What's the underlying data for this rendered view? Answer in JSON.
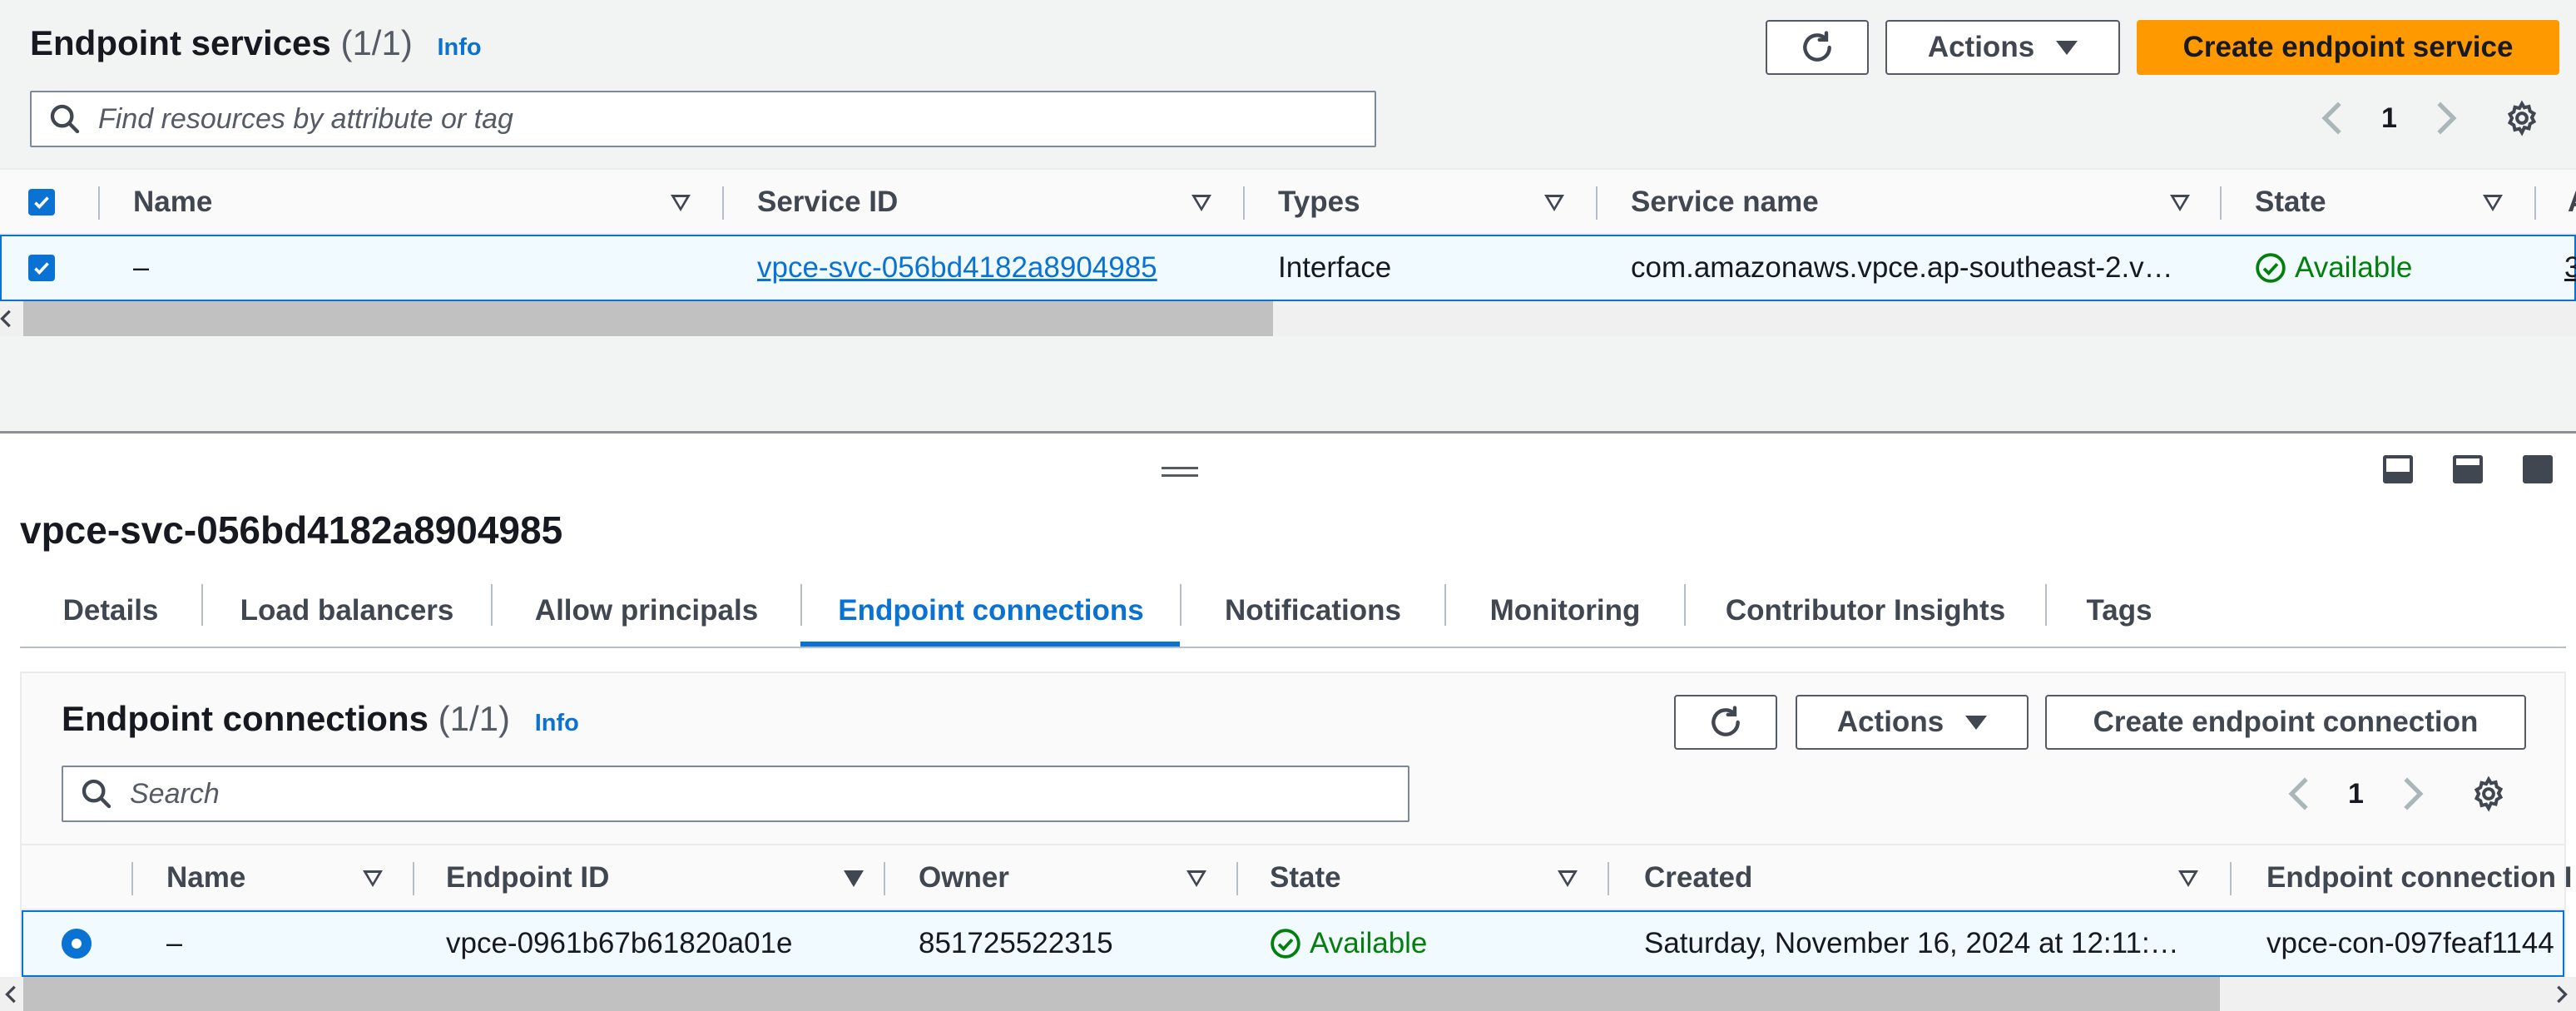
{
  "top": {
    "title": "Endpoint services",
    "count": "(1/1)",
    "info": "Info",
    "actions_label": "Actions",
    "create_label": "Create endpoint service",
    "search_placeholder": "Find resources by attribute or tag",
    "page": "1",
    "columns": [
      "Name",
      "Service ID",
      "Types",
      "Service name",
      "State",
      "A"
    ],
    "row": {
      "name": "–",
      "service_id": "vpce-svc-056bd4182a8904985",
      "type": "Interface",
      "service_name": "com.amazonaws.vpce.ap-southeast-2.v…",
      "state": "Available",
      "extra": "3"
    }
  },
  "detail": {
    "title": "vpce-svc-056bd4182a8904985",
    "tabs": [
      "Details",
      "Load balancers",
      "Allow principals",
      "Endpoint connections",
      "Notifications",
      "Monitoring",
      "Contributor Insights",
      "Tags"
    ],
    "active_tab": "Endpoint connections"
  },
  "connections": {
    "title": "Endpoint connections",
    "count": "(1/1)",
    "info": "Info",
    "actions_label": "Actions",
    "create_label": "Create endpoint connection",
    "search_placeholder": "Search",
    "page": "1",
    "columns": [
      "Name",
      "Endpoint ID",
      "Owner",
      "State",
      "Created",
      "Endpoint connection I"
    ],
    "row": {
      "name": "–",
      "endpoint_id": "vpce-0961b67b61820a01e",
      "owner": "851725522315",
      "state": "Available",
      "created": "Saturday, November 16, 2024 at 12:11:…",
      "connection_id": "vpce-con-097feaf1144"
    }
  },
  "colors": {
    "primary": "#ff9900",
    "link": "#0972d3",
    "success": "#037f0c"
  }
}
